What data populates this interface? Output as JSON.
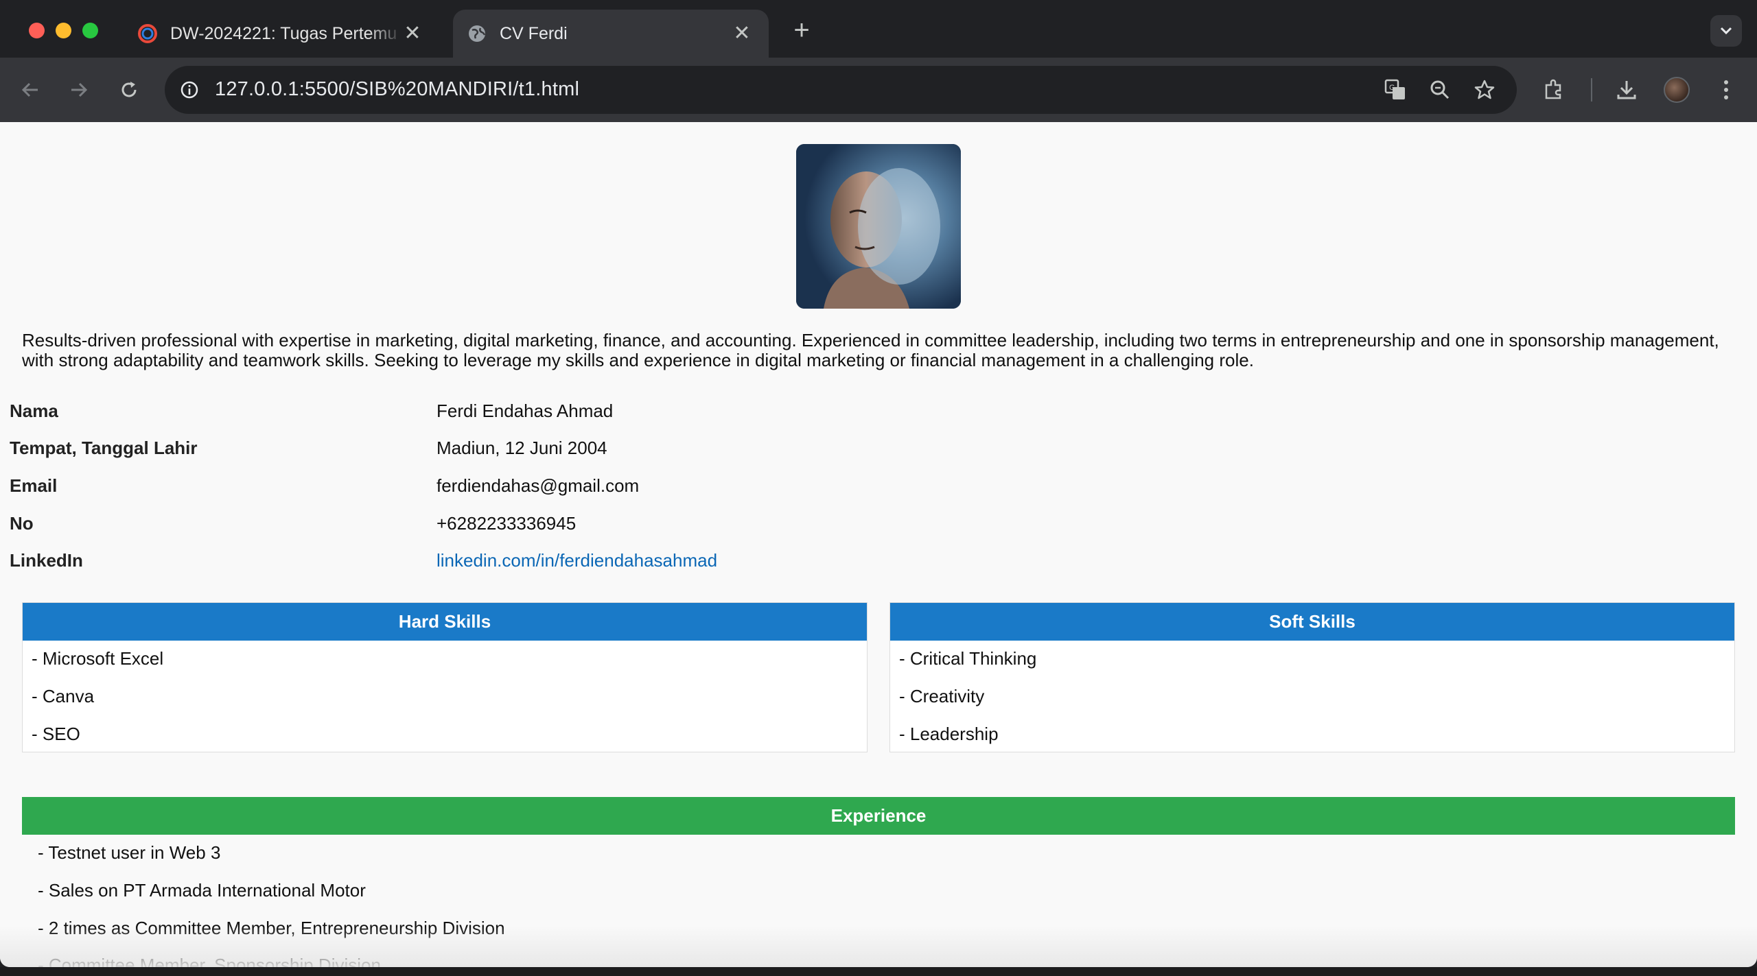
{
  "browser": {
    "tabs": [
      {
        "title": "DW-2024221: Tugas Pertemu",
        "active": false
      },
      {
        "title": "CV Ferdi",
        "active": true
      }
    ],
    "url": "127.0.0.1:5500/SIB%20MANDIRI/t1.html",
    "new_tab_symbol": "+",
    "close_symbol": "✕",
    "icons": [
      "back-icon",
      "forward-icon",
      "reload-icon",
      "site-info-icon",
      "translate-icon",
      "zoom-icon",
      "bookmark-star-icon",
      "extensions-icon",
      "download-icon",
      "profile-avatar",
      "more-menu-icon",
      "tab-search-icon"
    ]
  },
  "profile": {
    "summary": "Results-driven professional with expertise in marketing, digital marketing, finance, and accounting. Experienced in committee leadership, including two terms in entrepreneurship and one in sponsorship management, with strong adaptability and teamwork skills. Seeking to leverage my skills and experience in digital marketing or financial management in a challenging role.",
    "info": [
      {
        "label": "Nama",
        "value": "Ferdi Endahas Ahmad"
      },
      {
        "label": "Tempat, Tanggal Lahir",
        "value": "Madiun, 12 Juni 2004"
      },
      {
        "label": "Email",
        "value": "ferdiendahas@gmail.com"
      },
      {
        "label": "No",
        "value": "+6282233336945"
      },
      {
        "label": "LinkedIn",
        "value": "linkedin.com/in/ferdiendahasahmad"
      }
    ]
  },
  "hard_skills": {
    "title": "Hard Skills",
    "items": [
      "- Microsoft Excel",
      "- Canva",
      "- SEO"
    ]
  },
  "soft_skills": {
    "title": "Soft Skills",
    "items": [
      "- Critical Thinking",
      "- Creativity",
      "- Leadership"
    ]
  },
  "experience": {
    "title": "Experience",
    "items": [
      "- Testnet user in Web 3",
      "- Sales on PT Armada International Motor",
      "- 2 times as Committee Member, Entrepreneurship Division",
      "- Committee Member, Sponsorship Division"
    ]
  },
  "colors": {
    "hard_skills_header": "#1a7ac8",
    "soft_skills_header": "#1a7ac8",
    "experience_header": "#2fa84f",
    "link": "#0b67b5",
    "page_background": "#f9f9f9"
  }
}
